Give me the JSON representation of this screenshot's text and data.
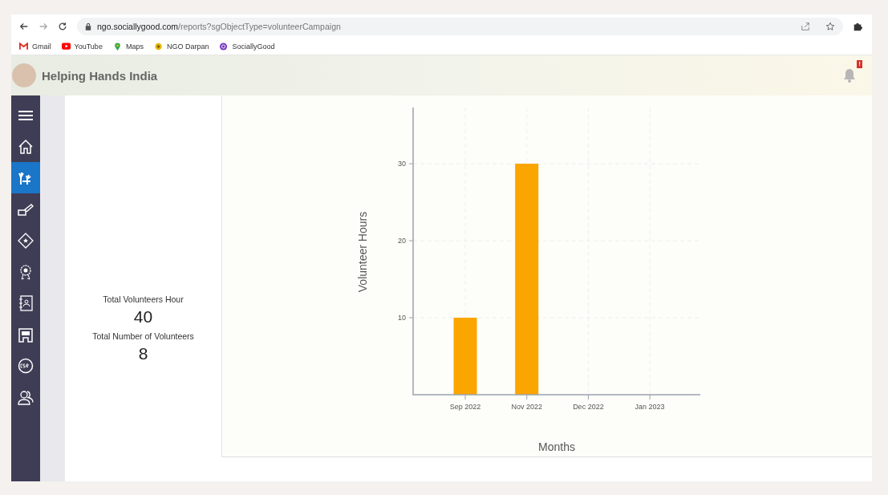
{
  "browser": {
    "url_host": "ngo.sociallygood.com",
    "url_path": "/reports?sgObjectType=volunteerCampaign",
    "bookmarks": [
      {
        "label": "Gmail",
        "kind": "gmail"
      },
      {
        "label": "YouTube",
        "kind": "youtube"
      },
      {
        "label": "Maps",
        "kind": "maps"
      },
      {
        "label": "NGO Darpan",
        "kind": "darpan"
      },
      {
        "label": "SociallyGood",
        "kind": "sg"
      }
    ]
  },
  "header": {
    "org_name": "Helping Hands India",
    "notification_badge": "!"
  },
  "sidebar": {
    "items": [
      {
        "kind": "menu",
        "selected": false
      },
      {
        "kind": "home",
        "selected": false
      },
      {
        "kind": "volunteer",
        "selected": true
      },
      {
        "kind": "donation",
        "selected": false
      },
      {
        "kind": "badge",
        "selected": false
      },
      {
        "kind": "award",
        "selected": false
      },
      {
        "kind": "contacts",
        "selected": false
      },
      {
        "kind": "ngo",
        "selected": false
      },
      {
        "kind": "csr",
        "selected": false
      },
      {
        "kind": "users",
        "selected": false
      }
    ]
  },
  "stats": [
    {
      "label": "Total Volunteers Hour",
      "value": "40"
    },
    {
      "label": "Total Number of Volunteers",
      "value": "8"
    }
  ],
  "chart_data": {
    "type": "bar",
    "xlabel": "Months",
    "ylabel": "Volunteer Hours",
    "categories": [
      "Sep 2022",
      "Nov 2022",
      "Dec 2022",
      "Jan 2023"
    ],
    "series": [
      {
        "color": "#fba500",
        "values": [
          10,
          30,
          null,
          null
        ]
      }
    ],
    "grid": true,
    "ylim": [
      0,
      37.3
    ],
    "yticks": [
      10,
      20,
      30
    ]
  }
}
